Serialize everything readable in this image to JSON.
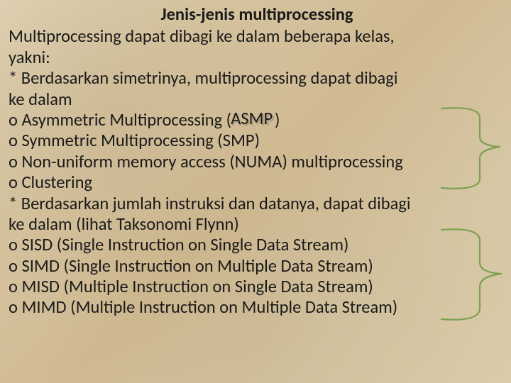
{
  "title": "Jenis-jenis multiprocessing",
  "intro1": "Multiprocessing dapat dibagi ke dalam beberapa kelas,",
  "intro2": "yakni:",
  "sec1a": "* Berdasarkan simetrinya, multiprocessing dapat dibagi",
  "sec1b": "ke dalam",
  "s1i1_pre": "o Asymmetric Multiprocessing (",
  "s1i1_abbr": "ASMP",
  "s1i1_post": ")",
  "s1i2": "o Symmetric Multiprocessing (SMP)",
  "s1i3": "o Non-uniform memory access (NUMA) multiprocessing",
  "s1i4": "o Clustering",
  "sec2a": "* Berdasarkan jumlah instruksi dan datanya, dapat dibagi",
  "sec2b": "ke dalam (lihat Taksonomi Flynn)",
  "s2i1": "o SISD (Single Instruction on Single Data Stream)",
  "s2i2": "o SIMD (Single Instruction on Multiple Data Stream)",
  "s2i3": "o MISD (Multiple Instruction on Single Data Stream)",
  "s2i4": "o MIMD (Multiple Instruction on Multiple Data Stream)"
}
